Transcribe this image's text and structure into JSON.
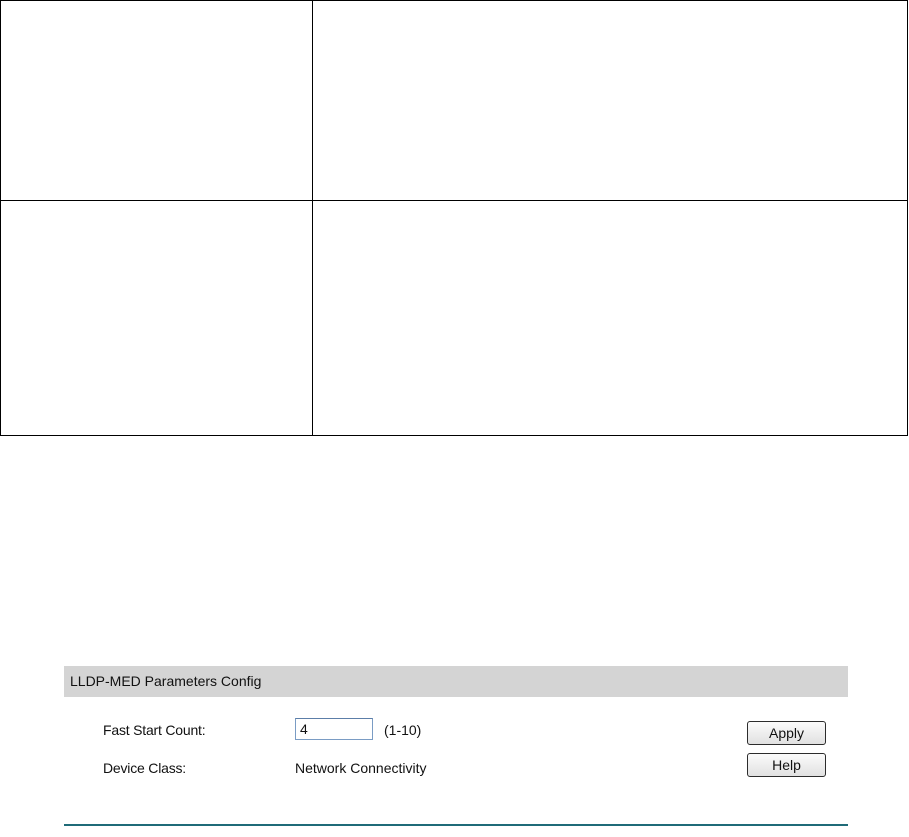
{
  "panel": {
    "title": "LLDP-MED Parameters Config",
    "fast_start": {
      "label": "Fast Start Count:",
      "value": "4",
      "range": "(1-10)"
    },
    "device_class": {
      "label": "Device Class:",
      "value": "Network Connectivity"
    },
    "buttons": {
      "apply": "Apply",
      "help": "Help"
    }
  },
  "colors": {
    "header_bg": "#d4d4d4",
    "rule": "#1f6b78"
  }
}
